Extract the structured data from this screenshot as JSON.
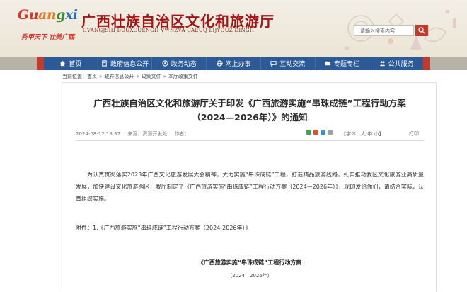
{
  "header": {
    "logo": {
      "word_parts": [
        "Gu",
        "an",
        "g",
        "xi"
      ],
      "slogan": "秀甲天下  壮美广西"
    },
    "title": "广西壮族自治区文化和旅游厅",
    "subtitle": "GVANGJSIH BOUXCUENGH VWNZVA CAEUQ LIJYOUZ DINGH",
    "search_placeholder": "请输入搜索内容",
    "search_icon": "search-icon"
  },
  "nav": {
    "items": [
      {
        "label": "首页",
        "icon": "home-icon"
      },
      {
        "label": "政府信息公开",
        "icon": "document-icon"
      },
      {
        "label": "政务动态",
        "icon": "news-icon"
      },
      {
        "label": "网上办事",
        "icon": "globe-icon"
      },
      {
        "label": "互动交流",
        "icon": "chat-icon"
      },
      {
        "label": "专题专栏",
        "icon": "folder-icon"
      },
      {
        "label": "公共服务",
        "icon": "people-icon"
      }
    ],
    "colors": {
      "bar": "#2b5a96",
      "accent": "#c23a2c"
    }
  },
  "breadcrumb": {
    "prefix": "当前位置：",
    "items": [
      "首页",
      "政府信息公开",
      "政策文件",
      "本厅政策文件"
    ]
  },
  "article": {
    "title_line1": "广西壮族自治区文化和旅游厅关于印发《广西旅游实施“串珠成链”工程行动方案",
    "title_line2": "（2024—2026年）》的通知",
    "date": "2024-08-12 18:37",
    "source": "来源：资源开发处",
    "author": "作者：",
    "fontsize": "【字体：大 中 小】",
    "print": "打印",
    "body": "为认真贯彻落实2023年广西文化旅游发展大会精神，大力实施“串珠成链”工程，打造精品旅游线路，扎实推动我区文化旅游业高质量发展，加快建设文化旅游强区，我厅制定了《广西旅游实施“串珠成链”工程行动方案（2024—2026年）》，现印发给你们，请结合实际，认真组织实施。",
    "attachment": "附件：1.《广西旅游实施“串珠成链”工程行动方案（2024-2026年）》",
    "doc_title": "《广西旅游实施“串珠成链”工程行动方案",
    "doc_date": "（2024—2026年）"
  }
}
